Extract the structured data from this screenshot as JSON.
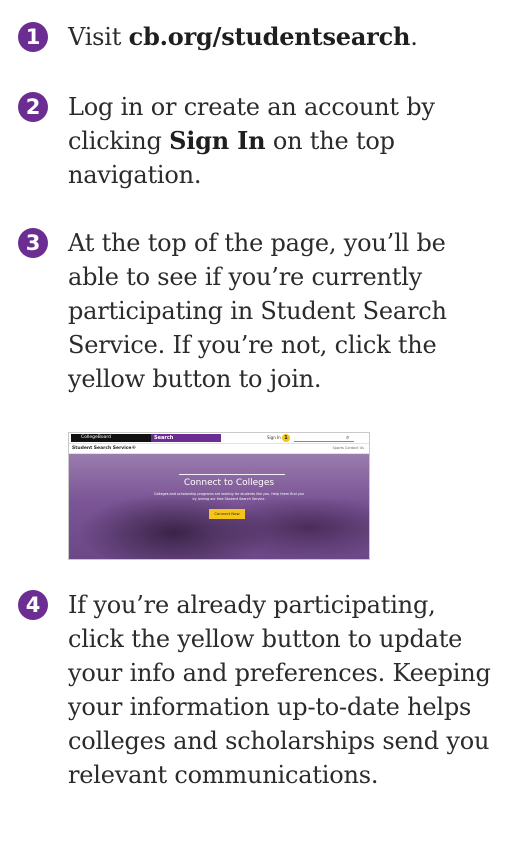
{
  "steps": [
    {
      "number": "1",
      "before": "Visit ",
      "bold": "cb.org/studentsearch",
      "after": "."
    },
    {
      "number": "2",
      "before": "Log in or create an account by clicking ",
      "bold": "Sign In",
      "after": " on the top navigation."
    },
    {
      "number": "3",
      "text": "At the top of the page, you’ll be able to see if you’re currently participating in Student Search Service. If you’re not, click the yellow button to join."
    },
    {
      "number": "4",
      "text": "If you’re already participating, click the yellow button to update your info and preferences. Keeping your information up-to-date helps colleges and scholarships send you relevant communications."
    }
  ],
  "screenshot": {
    "logo": "CollegeBoard",
    "search_tab": "Search",
    "sign_in": "Sign In",
    "notification_count": "1",
    "page_title": "Student Search Service®",
    "links": "Sports   Contact Us",
    "hero_title": "Connect to Colleges",
    "hero_desc": "Colleges and scholarship programs are looking for students like you. Help them find you by joining our free Student Search Service.",
    "cta": "Connect Now"
  },
  "colors": {
    "badge": "#6b2d91",
    "cta": "#f5c518",
    "text": "#2b2b2b"
  }
}
